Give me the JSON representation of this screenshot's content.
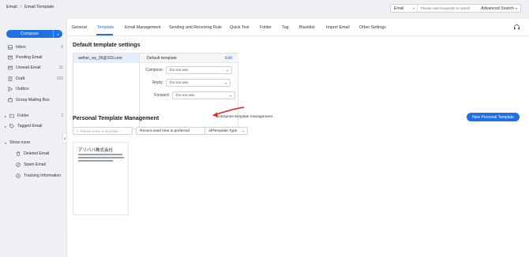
{
  "breadcrumb": {
    "root": "Email",
    "separator": ">",
    "current": "Email Template"
  },
  "search": {
    "scope": "Email",
    "placeholder": "Please enter keywords to search",
    "advanced_label": "Advanced Search"
  },
  "sidebar": {
    "compose_label": "Compose",
    "items": [
      {
        "label": "Inbox",
        "count": "6",
        "icon": "inbox-icon"
      },
      {
        "label": "Pending Email",
        "count": "",
        "icon": "pending-icon"
      },
      {
        "label": "Unread Email",
        "count": "11",
        "icon": "unread-icon"
      },
      {
        "label": "Draft",
        "count": "105",
        "icon": "draft-icon"
      },
      {
        "label": "Outbox",
        "count": "",
        "icon": "outbox-icon"
      },
      {
        "label": "Group Mailing Box",
        "count": "",
        "icon": "group-mail-icon"
      }
    ],
    "folder": {
      "label": "Folder",
      "count": "2"
    },
    "tagged": {
      "label": "Tagged Email"
    },
    "show_more": "Show more",
    "more_items": [
      {
        "label": "Deleted Email",
        "icon": "trash-icon"
      },
      {
        "label": "Spam Email",
        "icon": "spam-icon"
      },
      {
        "label": "Tracking Information",
        "icon": "tracking-icon"
      }
    ]
  },
  "tabs": [
    "General",
    "Template",
    "Email Management",
    "Sending and Receiving Rule",
    "Quick Text",
    "Folder",
    "Tag",
    "Blacklist",
    "Import Email",
    "Other Settings"
  ],
  "active_tab": "Template",
  "default_settings": {
    "title": "Default template settings",
    "account": "aether_wy_05@163.com",
    "header": "Default template",
    "edit_label": "Edit",
    "fields": [
      {
        "label": "Compose:",
        "value": "Do not use"
      },
      {
        "label": "Reply:",
        "value": "Do not use"
      },
      {
        "label": "Forward:",
        "value": "Do not use"
      }
    ]
  },
  "personal": {
    "title": "Personal Template Management",
    "enterprise_link": "Enterprise template management",
    "new_button": "New Personal Template",
    "filter_placeholder": "Please enter a template ...",
    "sort_value": "Recent used time is preferred",
    "type_value": "AllTemplate Type",
    "template_card_title": "アリババ株式会社"
  },
  "colors": {
    "accent": "#1f6fe5",
    "arrow": "#e0232a"
  }
}
